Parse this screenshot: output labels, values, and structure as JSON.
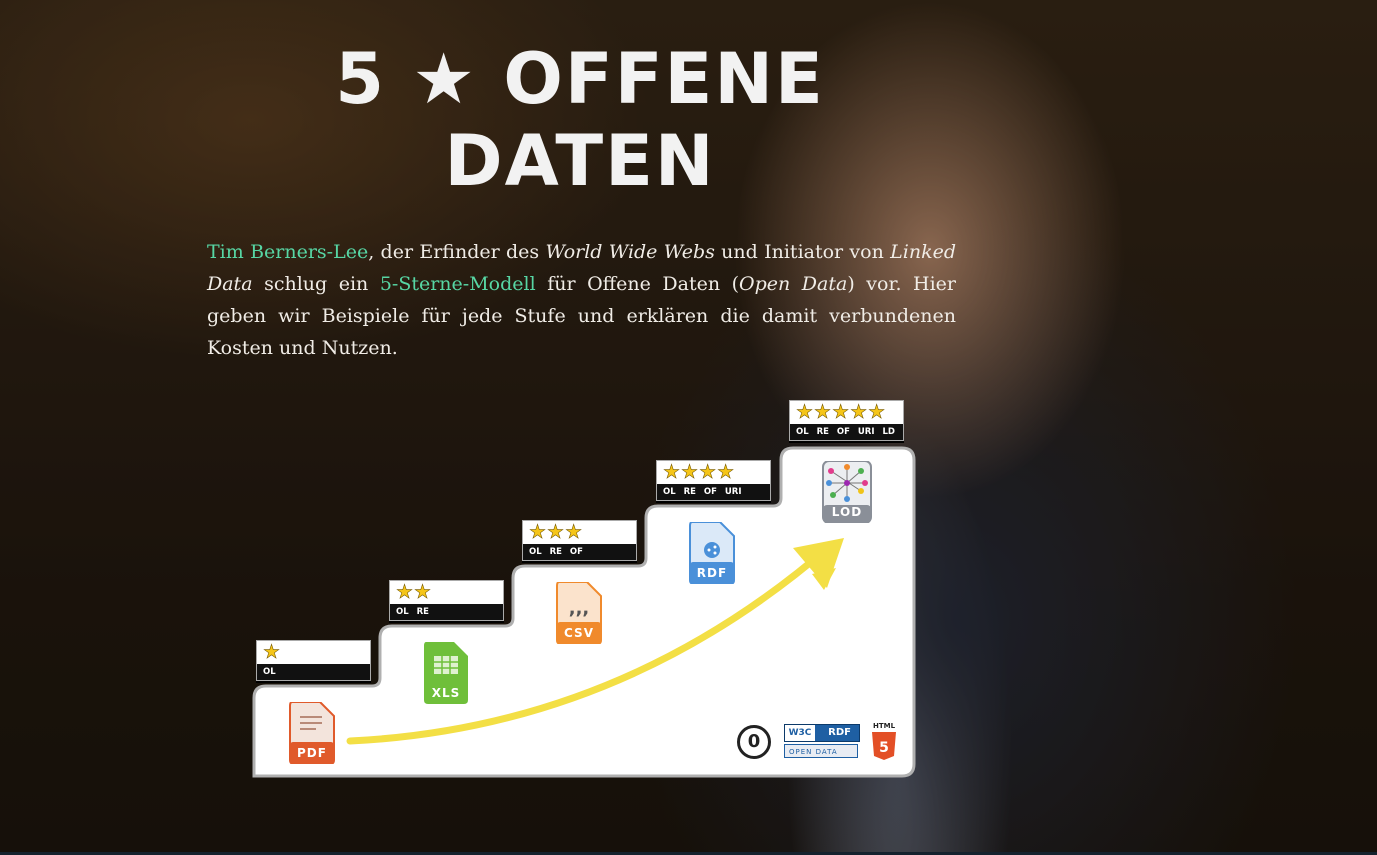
{
  "title": {
    "line1": "5 ★ OFFENE",
    "line2": "DATEN"
  },
  "intro": {
    "link_tbl": "Tim Berners-Lee",
    "t1": ", der Erfinder des ",
    "em_www": "World Wide Webs",
    "t2": " und Initiator von ",
    "em_ld": "Linked Data",
    "t3": " schlug ein ",
    "link_model": "5-Sterne-Modell",
    "t4": " für Offene Daten (",
    "em_od": "Open Data",
    "t5": ") vor. Hier geben wir Beispiele für jede Stufe und erklären die damit verbundenen Kosten und Nutzen."
  },
  "steps": [
    {
      "stars": "★",
      "codes": "OL",
      "file_label": "PDF",
      "file_color": "#e05a2b"
    },
    {
      "stars": "★★",
      "codes": "OL RE",
      "file_label": "XLS",
      "file_color": "#6fbf3a"
    },
    {
      "stars": "★★★",
      "codes": "OL RE OF",
      "file_label": "CSV",
      "file_color": "#f08a2c"
    },
    {
      "stars": "★★★★",
      "codes": "OL RE OF URI",
      "file_label": "RDF",
      "file_color": "#4a90d9"
    },
    {
      "stars": "★★★★★",
      "codes": "OL RE OF URI LD",
      "file_label": "LOD",
      "file_color": "#8a8f98"
    }
  ],
  "license": {
    "cc0": "0",
    "w3c": "W3C",
    "rdf": "RDF",
    "open_data": "OPEN DATA",
    "html5": "HTML"
  },
  "colors": {
    "accent_link": "#57d6a4",
    "star": "#f5c518",
    "arrow": "#f3df45"
  }
}
